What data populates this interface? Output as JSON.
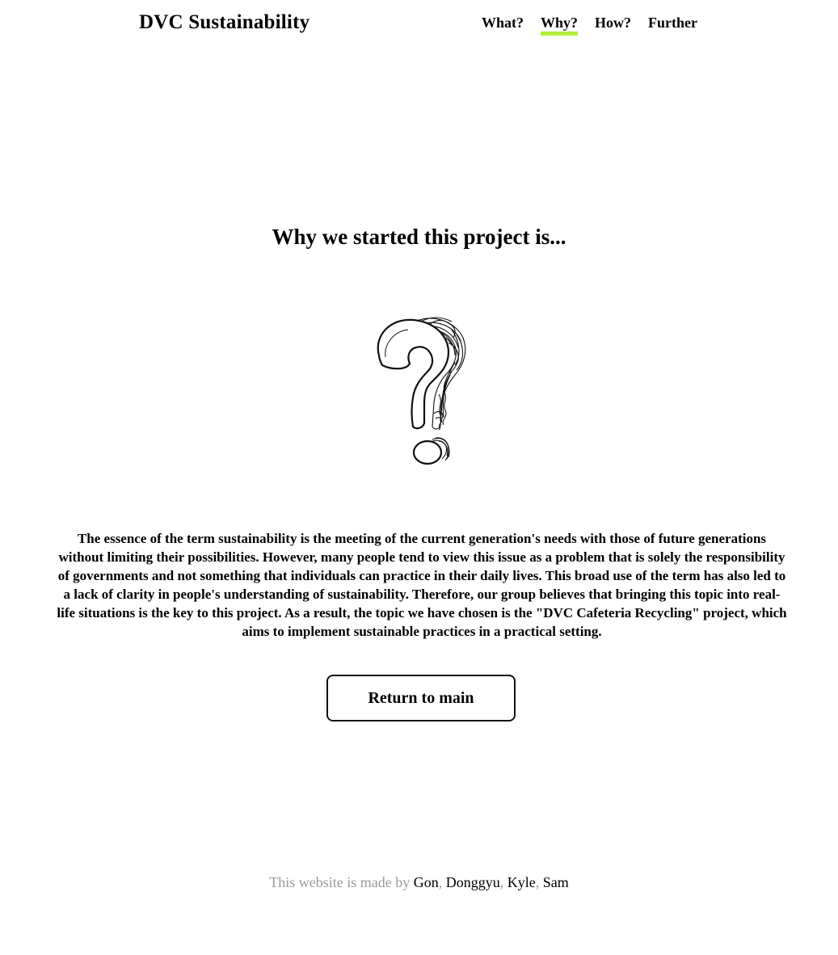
{
  "header": {
    "brand": "DVC Sustainability",
    "nav": [
      {
        "label": "What?"
      },
      {
        "label": "Why?",
        "active": true
      },
      {
        "label": "How?"
      },
      {
        "label": "Further"
      }
    ],
    "active_underline_color": "#b2ee3a"
  },
  "main": {
    "heading": "Why we started this project is...",
    "illustration": "question-mark-icon",
    "body": "The essence of the term sustainability is the meeting of the current generation's needs with those of future generations without limiting their possibilities. However, many people tend to view this issue as a problem that is solely the responsibility of governments and not something that individuals can practice in their daily lives. This broad use of the term has also led to a lack of clarity in people's understanding of sustainability. Therefore, our group believes that bringing this topic into real-life situations is the key to this project. As a result, the topic we have chosen is the \"DVC Cafeteria Recycling\" project, which aims to implement sustainable practices in a practical setting.",
    "return_label": "Return to main"
  },
  "footer": {
    "prefix": "This website is made by",
    "authors": [
      "Gon",
      "Donggyu",
      "Kyle",
      "Sam"
    ],
    "separator": ","
  }
}
